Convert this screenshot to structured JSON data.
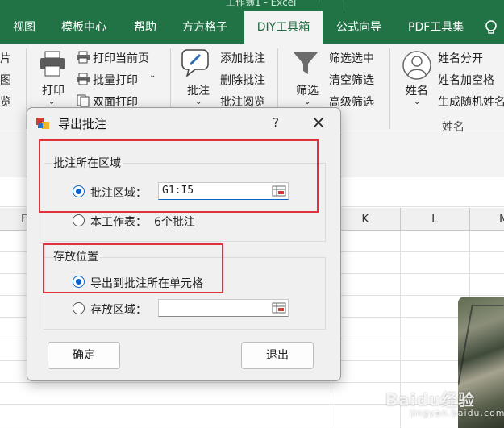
{
  "titlebar": {
    "text": "工作簿1 - Excel"
  },
  "tabs": [
    {
      "label": "视图"
    },
    {
      "label": "模板中心"
    },
    {
      "label": "帮助"
    },
    {
      "label": "方方格子"
    },
    {
      "label": "DIY工具箱"
    },
    {
      "label": "公式向导"
    },
    {
      "label": "PDF工具集"
    }
  ],
  "ribbon": {
    "left_partial": [
      "片",
      "图",
      "览"
    ],
    "print": {
      "big_label": "打印",
      "print_current": "打印当前页",
      "batch_print": "批量打印",
      "duplex_print": "双面打印"
    },
    "comment": {
      "big_label": "批注",
      "add": "添加批注",
      "delete": "删除批注",
      "browse": "批注阅览"
    },
    "filter": {
      "big_label": "筛选",
      "filter_all": "筛选选中",
      "clear": "清空筛选",
      "advanced": "高级筛选"
    },
    "name": {
      "big_label": "姓名",
      "split": "姓名分开",
      "add_space": "姓名加空格",
      "random": "生成随机姓名"
    },
    "name_group_label": "姓名"
  },
  "columns": [
    "F",
    "K",
    "L",
    "M"
  ],
  "dialog": {
    "title": "导出批注",
    "help": "?",
    "group1": {
      "label": "批注所在区域",
      "option1": "批注区域：",
      "range_value": "G1:I5",
      "option2": "本工作表：",
      "count_text": "6个批注"
    },
    "group2": {
      "label": "存放位置",
      "option1": "导出到批注所在单元格",
      "option2": "存放区域：",
      "store_value": ""
    },
    "ok": "确定",
    "exit": "退出"
  },
  "watermark": {
    "text": "Baidu经验",
    "sub": "jingyan.baidu.com"
  },
  "colors": {
    "excel_green": "#217346",
    "highlight_red": "#e0303a",
    "radio_blue": "#0a64c8"
  }
}
